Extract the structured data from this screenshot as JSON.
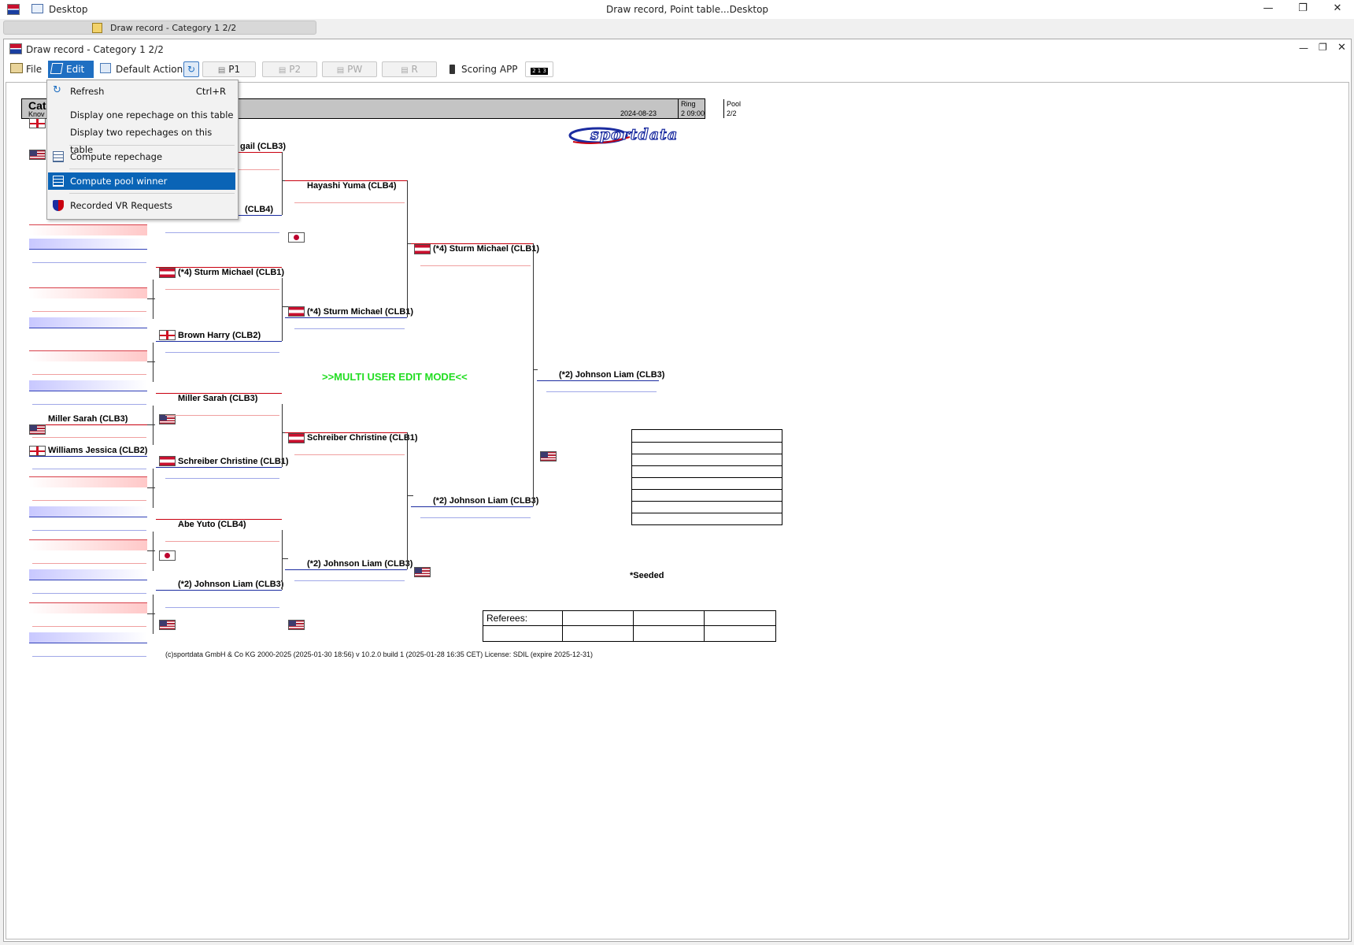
{
  "outer_window": {
    "app_label": "Desktop",
    "title": "Draw record, Point table...Desktop",
    "task_tab": "Draw record - Category 1 2/2"
  },
  "inner_window": {
    "title": "Draw record - Category 1 2/2"
  },
  "toolbar": {
    "file": "File",
    "edit": "Edit",
    "default_action": "Default Action",
    "p1": "P1",
    "p2": "P2",
    "pw": "PW",
    "r": "R",
    "scoring_app": "Scoring APP",
    "podium_numbers": "2 1 3"
  },
  "edit_menu": {
    "items": [
      {
        "label": "Refresh",
        "shortcut": "Ctrl+R",
        "icon": "refresh-icon"
      },
      {
        "label": "Display one repechage on this table"
      },
      {
        "label": "Display two repechages on this table"
      },
      {
        "label": "Compute repechage",
        "icon": "table-icon"
      },
      {
        "label": "Compute pool winner",
        "icon": "table-icon",
        "selected": true
      },
      {
        "label": "Recorded VR Requests",
        "icon": "shield-icon"
      }
    ]
  },
  "header": {
    "category_short": "Cat",
    "category_sub": "Knov",
    "date": "2024-08-23",
    "ring_label": "Ring",
    "ring_value": "2 09:00",
    "pool_label": "Pool",
    "pool_value": "2/2"
  },
  "logo_text": "sportdata",
  "bracket": {
    "round1_left": [
      {
        "name": "Miller Sarah (CLB3)",
        "flag": "usa"
      },
      {
        "name": "Williams Jessica (CLB2)",
        "flag": "eng"
      }
    ],
    "round2": [
      {
        "name": "gail (CLB3)"
      },
      {
        "name": "(CLB4)"
      },
      {
        "name": "(*4) Sturm Michael (CLB1)",
        "flag": "aut"
      },
      {
        "name": "Brown Harry (CLB2)",
        "flag": "eng"
      },
      {
        "name": "Miller Sarah (CLB3)",
        "flag": "usa"
      },
      {
        "name": "Schreiber Christine (CLB1)",
        "flag": "aut"
      },
      {
        "name": "Abe Yuto (CLB4)",
        "flag": "jpn"
      },
      {
        "name": "(*2) Johnson Liam (CLB3)",
        "flag": "usa"
      }
    ],
    "round3": [
      {
        "name": "Hayashi Yuma (CLB4)",
        "flag": "jpn"
      },
      {
        "name": "(*4) Sturm Michael (CLB1)",
        "flag": "aut"
      },
      {
        "name": "Schreiber Christine (CLB1)",
        "flag": "aut"
      },
      {
        "name": "(*2) Johnson Liam (CLB3)",
        "flag": "usa"
      }
    ],
    "round4": [
      {
        "name": "(*4) Sturm Michael (CLB1)",
        "flag": "aut"
      },
      {
        "name": "(*2) Johnson Liam (CLB3)",
        "flag": "usa"
      }
    ],
    "winner": {
      "name": "(*2) Johnson Liam (CLB3)",
      "flag": "usa"
    }
  },
  "multi_user_text": ">>MULTI USER EDIT MODE<<",
  "seeded_note": "*Seeded",
  "referees_label": "Referees:",
  "footer": "(c)sportdata GmbH & Co KG 2000-2025 (2025-01-30 18:56)  v 10.2.0 build 1 (2025-01-28 16:35 CET) License: SDIL (expire 2025-12-31)",
  "colors": {
    "menu_highlight": "#0a64b6",
    "edit_highlight": "#1f6fc2",
    "multi_user_text": "#22dd22",
    "red_corner": "#c9000f",
    "blue_corner": "#1b2ca0"
  }
}
